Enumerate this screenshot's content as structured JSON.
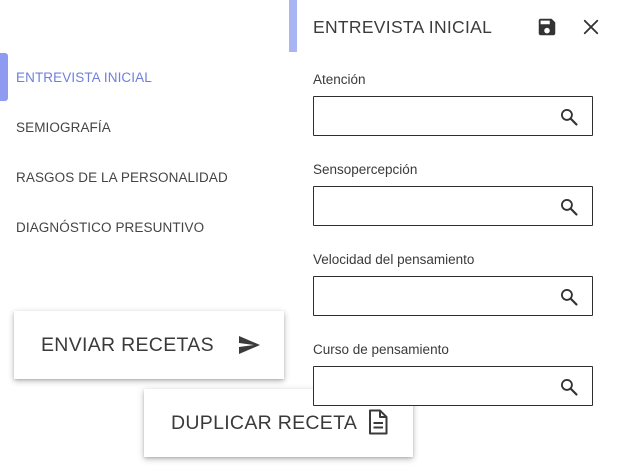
{
  "nav": {
    "items": [
      {
        "label": "ENTREVISTA INICIAL",
        "active": true
      },
      {
        "label": "SEMIOGRAFÍA",
        "active": false
      },
      {
        "label": "RASGOS DE LA PERSONALIDAD",
        "active": false
      },
      {
        "label": "DIAGNÓSTICO PRESUNTIVO",
        "active": false
      }
    ]
  },
  "actions": {
    "send_label": "ENVIAR RECETAS",
    "send_icon": "send-icon",
    "duplicate_label": "DUPLICAR RECETA",
    "duplicate_icon": "document-icon"
  },
  "panel": {
    "title": "ENTREVISTA INICIAL",
    "save_icon": "save-icon",
    "close_icon": "close-icon",
    "fields": [
      {
        "label": "Atención",
        "value": "",
        "icon": "search-icon"
      },
      {
        "label": "Sensopercepción",
        "value": "",
        "icon": "search-icon"
      },
      {
        "label": "Velocidad del pensamiento",
        "value": "",
        "icon": "search-icon"
      },
      {
        "label": "Curso de pensamiento",
        "value": "",
        "icon": "search-icon"
      }
    ]
  },
  "colors": {
    "accent": "#8f9bf0",
    "active_text": "#6f7fdc",
    "text": "#3a3a3a"
  }
}
